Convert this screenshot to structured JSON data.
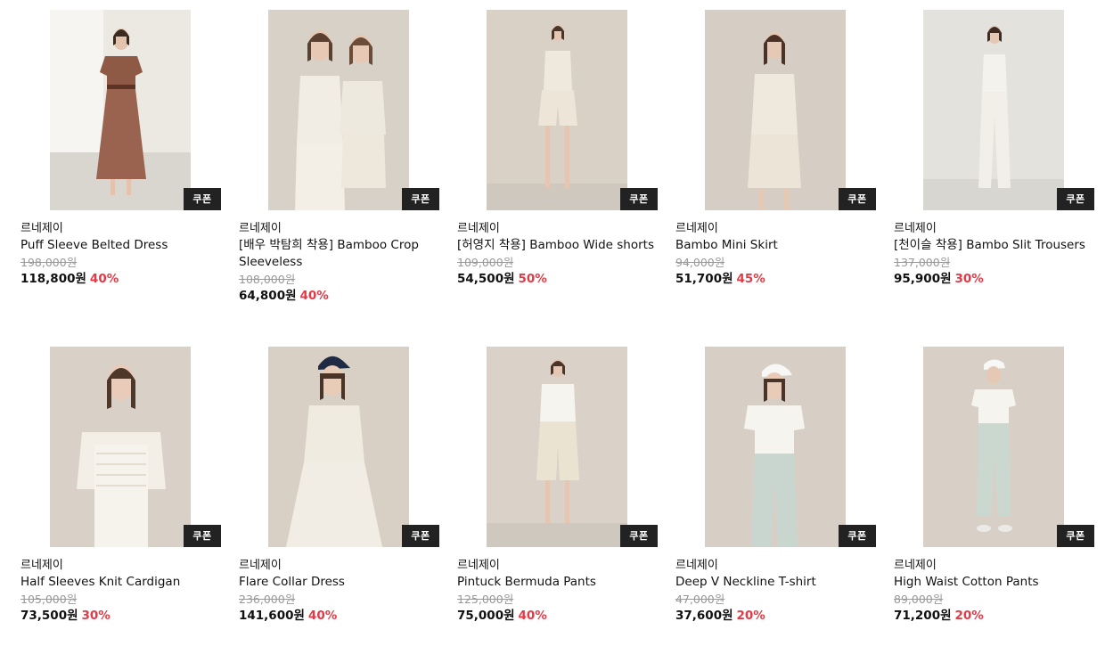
{
  "coupon_label": "쿠폰",
  "colors": {
    "discount": "#e63946",
    "coupon_bg": "#222222",
    "text": "#111111",
    "strike": "#999999"
  },
  "products": [
    {
      "brand": "르네제이",
      "name": "Puff Sleeve Belted Dress",
      "original_price": "198,000원",
      "sale_price": "118,800원",
      "discount": "40%",
      "photo": "brown-belted-dress"
    },
    {
      "brand": "르네제이",
      "name": "[배우 박탐희 착용] Bamboo Crop Sleeveless",
      "original_price": "108,000원",
      "sale_price": "64,800원",
      "discount": "40%",
      "photo": "cream-crop-sleeveless"
    },
    {
      "brand": "르네제이",
      "name": "[허영지 착용] Bamboo Wide shorts",
      "original_price": "109,000원",
      "sale_price": "54,500원",
      "discount": "50%",
      "photo": "cream-wide-shorts"
    },
    {
      "brand": "르네제이",
      "name": "Bambo Mini Skirt",
      "original_price": "94,000원",
      "sale_price": "51,700원",
      "discount": "45%",
      "photo": "cream-mini-skirt"
    },
    {
      "brand": "르네제이",
      "name": "[천이슬 착용] Bambo Slit Trousers",
      "original_price": "137,000원",
      "sale_price": "95,900원",
      "discount": "30%",
      "photo": "white-slit-trousers"
    },
    {
      "brand": "르네제이",
      "name": "Half Sleeves Knit Cardigan",
      "original_price": "105,000원",
      "sale_price": "73,500원",
      "discount": "30%",
      "photo": "cream-knit-cardigan"
    },
    {
      "brand": "르네제이",
      "name": "Flare Collar Dress",
      "original_price": "236,000원",
      "sale_price": "141,600원",
      "discount": "40%",
      "photo": "cream-collar-dress"
    },
    {
      "brand": "르네제이",
      "name": "Pintuck Bermuda Pants",
      "original_price": "125,000원",
      "sale_price": "75,000원",
      "discount": "40%",
      "photo": "cream-bermuda-pants"
    },
    {
      "brand": "르네제이",
      "name": "Deep V Neckline T-shirt",
      "original_price": "47,000원",
      "sale_price": "37,600원",
      "discount": "20%",
      "photo": "white-vneck-tshirt"
    },
    {
      "brand": "르네제이",
      "name": "High Waist Cotton Pants",
      "original_price": "89,000원",
      "sale_price": "71,200원",
      "discount": "20%",
      "photo": "mint-cotton-pants"
    }
  ]
}
